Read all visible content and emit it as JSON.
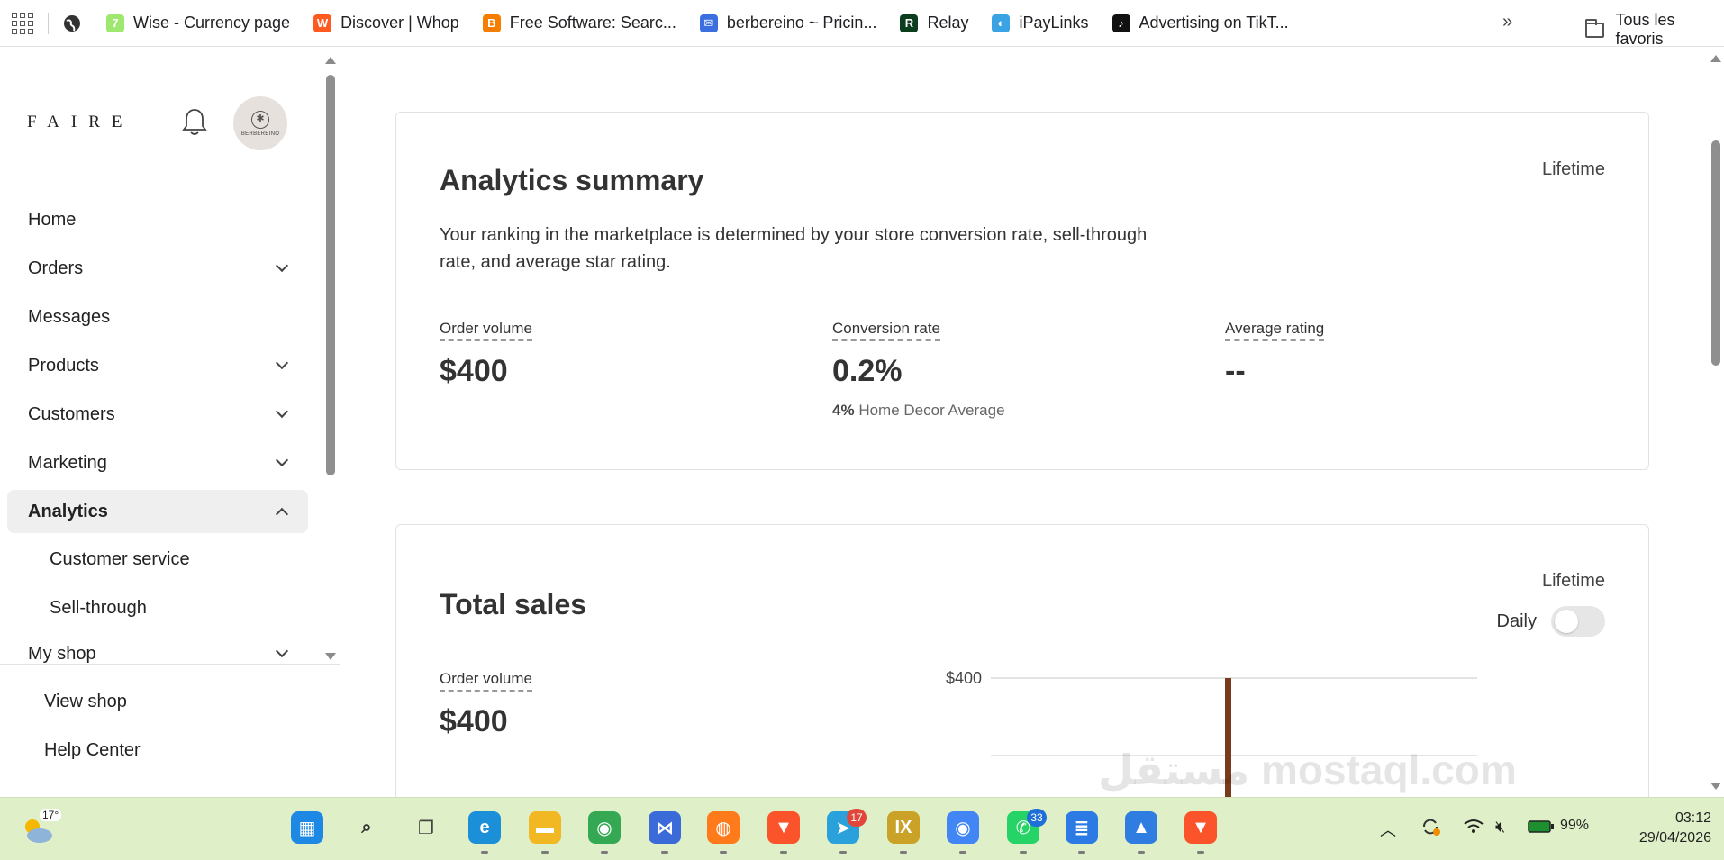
{
  "bookmarks": {
    "items": [
      {
        "label": "Wise - Currency page",
        "icon": "wise-icon",
        "color": "#9fe870",
        "glyph": "7"
      },
      {
        "label": "Discover | Whop",
        "icon": "whop-icon",
        "color": "#ff5a1f",
        "glyph": "W"
      },
      {
        "label": "Free Software: Searc...",
        "icon": "blogger-icon",
        "color": "#f57d00",
        "glyph": "B"
      },
      {
        "label": "berbereino ~ Pricin...",
        "icon": "mail-icon",
        "color": "#3b6fe0",
        "glyph": "✉"
      },
      {
        "label": "Relay",
        "icon": "relay-icon",
        "color": "#0b3d1e",
        "glyph": "R"
      },
      {
        "label": "iPayLinks",
        "icon": "ipaylinks-icon",
        "color": "#3aa3e3",
        "glyph": "◐"
      },
      {
        "label": "Advertising on TikT...",
        "icon": "tiktok-icon",
        "color": "#111111",
        "glyph": "♪"
      }
    ],
    "more": "»",
    "all_bookmarks": "Tous les favoris"
  },
  "sidebar": {
    "logo": "FAIRE",
    "avatar_text": "BERBEREINO",
    "nav": [
      {
        "label": "Home",
        "chevron": false
      },
      {
        "label": "Orders",
        "chevron": true
      },
      {
        "label": "Messages",
        "chevron": false
      },
      {
        "label": "Products",
        "chevron": true
      },
      {
        "label": "Customers",
        "chevron": true
      },
      {
        "label": "Marketing",
        "chevron": true
      },
      {
        "label": "Analytics",
        "chevron": true,
        "expanded": true,
        "active": true
      }
    ],
    "sub": [
      {
        "label": "Customer service"
      },
      {
        "label": "Sell-through"
      }
    ],
    "my_shop": "My shop",
    "footer": [
      {
        "label": "View shop"
      },
      {
        "label": "Help Center"
      }
    ]
  },
  "analytics_summary": {
    "title": "Analytics summary",
    "period": "Lifetime",
    "description": "Your ranking in the marketplace is determined by your store conversion rate, sell-through rate, and average star rating.",
    "metrics": [
      {
        "label": "Order volume",
        "value": "$400"
      },
      {
        "label": "Conversion rate",
        "value": "0.2%",
        "compare_value": "4%",
        "compare_label": "Home Decor Average"
      },
      {
        "label": "Average rating",
        "value": "--"
      }
    ]
  },
  "total_sales": {
    "title": "Total sales",
    "period": "Lifetime",
    "toggle_label": "Daily",
    "toggle_on": false,
    "metric_label": "Order volume",
    "metric_value": "$400"
  },
  "chart_data": {
    "type": "bar",
    "title": "",
    "y_tick_labels": [
      "$400"
    ],
    "ylim": [
      0,
      400
    ],
    "values": [
      400
    ],
    "bar_color": "#7a3b1a",
    "grid": true
  },
  "watermark": "مستقل mostaql.com",
  "taskbar": {
    "weather_temp": "17°",
    "apps": [
      {
        "name": "windows-start-icon",
        "color": "#1e88e5",
        "glyph": "▦"
      },
      {
        "name": "search-icon",
        "color": "#333333",
        "glyph": "⌕"
      },
      {
        "name": "task-view-icon",
        "color": "#444444",
        "glyph": "❐"
      },
      {
        "name": "edge-icon",
        "color": "#1b8fd8",
        "glyph": "e"
      },
      {
        "name": "file-explorer-icon",
        "color": "#f2b824",
        "glyph": "▬"
      },
      {
        "name": "chrome-icon",
        "color": "#34a853",
        "glyph": "◉"
      },
      {
        "name": "visual-studio-icon",
        "color": "#3a6bd8",
        "glyph": "⋈"
      },
      {
        "name": "firefox-icon",
        "color": "#ff7a1a",
        "glyph": "◍"
      },
      {
        "name": "brave-icon",
        "color": "#fb542b",
        "glyph": "▼"
      },
      {
        "name": "telegram-icon",
        "color": "#2aa1db",
        "glyph": "➤",
        "badge": "17"
      },
      {
        "name": "ix-browser-icon",
        "color": "#c9a227",
        "glyph": "IX"
      },
      {
        "name": "chrome-profile-icon",
        "color": "#4285f4",
        "glyph": "◉"
      },
      {
        "name": "whatsapp-icon",
        "color": "#25d366",
        "glyph": "✆",
        "badge": "33"
      },
      {
        "name": "notepad-icon",
        "color": "#2c7be5",
        "glyph": "≣"
      },
      {
        "name": "photos-icon",
        "color": "#2f7de1",
        "glyph": "▲"
      },
      {
        "name": "brave-alt-icon",
        "color": "#fb542b",
        "glyph": "▼"
      }
    ],
    "battery": "99%",
    "time": "03:12",
    "date": "29/04/2026"
  }
}
